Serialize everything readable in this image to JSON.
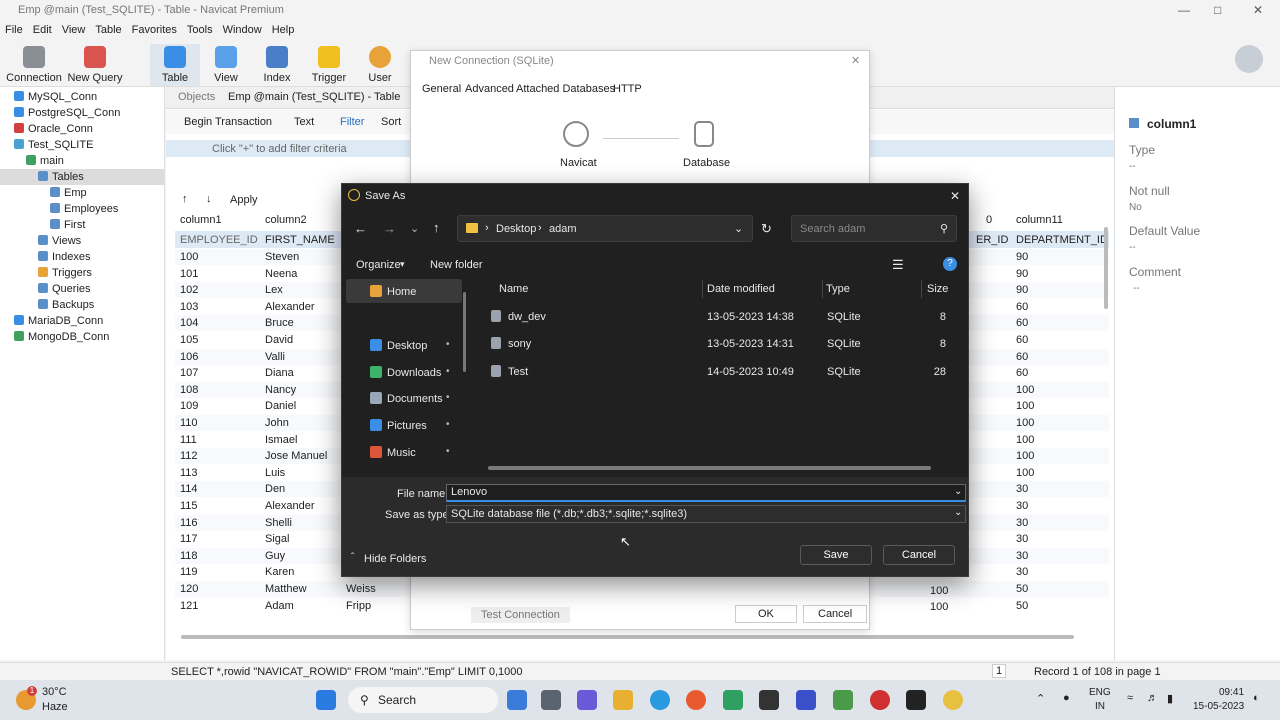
{
  "app": {
    "title": "Emp @main (Test_SQLITE) - Table - Navicat Premium",
    "menu": [
      "File",
      "Edit",
      "View",
      "Table",
      "Favorites",
      "Tools",
      "Window",
      "Help"
    ],
    "toolbar": [
      "Connection",
      "New Query",
      "Table",
      "View",
      "Index",
      "Trigger",
      "User"
    ]
  },
  "tree": [
    {
      "label": "MySQL_Conn",
      "indent": 0
    },
    {
      "label": "PostgreSQL_Conn",
      "indent": 0
    },
    {
      "label": "Oracle_Conn",
      "indent": 0
    },
    {
      "label": "Test_SQLITE",
      "indent": 0
    },
    {
      "label": "main",
      "indent": 1
    },
    {
      "label": "Tables",
      "indent": 2
    },
    {
      "label": "Emp",
      "indent": 3
    },
    {
      "label": "Employees",
      "indent": 3
    },
    {
      "label": "First",
      "indent": 3
    },
    {
      "label": "Views",
      "indent": 2
    },
    {
      "label": "Indexes",
      "indent": 2
    },
    {
      "label": "Triggers",
      "indent": 2
    },
    {
      "label": "Queries",
      "indent": 2
    },
    {
      "label": "Backups",
      "indent": 2
    },
    {
      "label": "MariaDB_Conn",
      "indent": 0
    },
    {
      "label": "MongoDB_Conn",
      "indent": 0
    }
  ],
  "tabs": {
    "objects": "Objects",
    "emp": "Emp @main (Test_SQLITE) - Table"
  },
  "subtool": {
    "begin": "Begin Transaction",
    "text": "Text",
    "filter": "Filter",
    "sort": "Sort",
    "apply": "Apply"
  },
  "filter_hint": "Click \"+\" to add filter criteria",
  "grid": {
    "col1": "column1",
    "col2": "column2",
    "col_right1": "0",
    "col_right2": "column11",
    "hdr_row": {
      "c1": "EMPLOYEE_ID",
      "c2": "FIRST_NAME",
      "c3": "ER_ID",
      "c4": "DEPARTMENT_ID"
    },
    "rows": [
      [
        "100",
        "Steven",
        "",
        "90"
      ],
      [
        "101",
        "Neena",
        "",
        "90"
      ],
      [
        "102",
        "Lex",
        "",
        "90"
      ],
      [
        "103",
        "Alexander",
        "",
        "60"
      ],
      [
        "104",
        "Bruce",
        "",
        "60"
      ],
      [
        "105",
        "David",
        "",
        "60"
      ],
      [
        "106",
        "Valli",
        "",
        "60"
      ],
      [
        "107",
        "Diana",
        "",
        "60"
      ],
      [
        "108",
        "Nancy",
        "",
        "100"
      ],
      [
        "109",
        "Daniel",
        "",
        "100"
      ],
      [
        "110",
        "John",
        "",
        "100"
      ],
      [
        "111",
        "Ismael",
        "",
        "100"
      ],
      [
        "112",
        "Jose Manuel",
        "",
        "100"
      ],
      [
        "113",
        "Luis",
        "",
        "100"
      ],
      [
        "114",
        "Den",
        "",
        "30"
      ],
      [
        "115",
        "Alexander",
        "",
        "30"
      ],
      [
        "116",
        "Shelli",
        "",
        "30"
      ],
      [
        "117",
        "Sigal",
        "",
        "30"
      ],
      [
        "118",
        "Guy",
        "",
        "30"
      ],
      [
        "119",
        "Karen",
        "",
        "30"
      ],
      [
        "120",
        "Matthew",
        "Weiss",
        "50"
      ],
      [
        "121",
        "Adam",
        "Fripp",
        "50"
      ]
    ],
    "extra_col": {
      "r120": "100",
      "r121": "100"
    }
  },
  "rightpanel": {
    "field": "column1",
    "type": "Type",
    "type_v": "--",
    "notnull": "Not null",
    "notnull_v": "No",
    "default": "Default Value",
    "default_v": "--",
    "comment": "Comment",
    "comment_v": "--"
  },
  "status": {
    "sql": "SELECT *,rowid \"NAVICAT_ROWID\" FROM \"main\".\"Emp\" LIMIT 0,1000",
    "page": "1",
    "record": "Record 1 of 108 in page 1"
  },
  "newconn": {
    "title": "New Connection (SQLite)",
    "tabs": [
      "General",
      "Advanced",
      "Attached Databases",
      "HTTP"
    ],
    "navicat": "Navicat",
    "database": "Database",
    "test": "Test Connection",
    "ok": "OK",
    "cancel": "Cancel"
  },
  "saveas": {
    "title": "Save As",
    "path": [
      "Desktop",
      "adam"
    ],
    "search_placeholder": "Search adam",
    "organize": "Organize",
    "newfolder": "New folder",
    "sidebar": [
      {
        "label": "Home",
        "color": "#e8a23a"
      },
      {
        "label": "Desktop",
        "color": "#3a8ee6"
      },
      {
        "label": "Downloads",
        "color": "#3ab56a"
      },
      {
        "label": "Documents",
        "color": "#9aa7b8"
      },
      {
        "label": "Pictures",
        "color": "#3a8ee6"
      },
      {
        "label": "Music",
        "color": "#e0553a"
      }
    ],
    "columns": {
      "name": "Name",
      "date": "Date modified",
      "type": "Type",
      "size": "Size"
    },
    "files": [
      {
        "name": "dw_dev",
        "date": "13-05-2023 14:38",
        "type": "SQLite",
        "size": "8"
      },
      {
        "name": "sony",
        "date": "13-05-2023 14:31",
        "type": "SQLite",
        "size": "8"
      },
      {
        "name": "Test",
        "date": "14-05-2023 10:49",
        "type": "SQLite",
        "size": "28"
      }
    ],
    "filename_label": "File name:",
    "filename": "Lenovo",
    "savetype_label": "Save as type:",
    "savetype": "SQLite database file (*.db;*.db3;*.sqlite;*.sqlite3)",
    "hide": "Hide Folders",
    "save": "Save",
    "cancel": "Cancel"
  },
  "taskbar": {
    "temp": "30°C",
    "weather": "Haze",
    "badge": "1",
    "search": "Search",
    "lang1": "ENG",
    "lang2": "IN",
    "time": "09:41",
    "date": "15-05-2023"
  }
}
